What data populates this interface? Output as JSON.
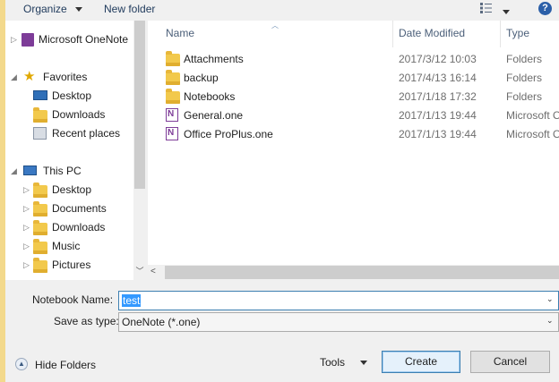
{
  "toolbar": {
    "organize_label": "Organize",
    "new_folder_label": "New folder"
  },
  "nav": {
    "onenote_label": "Microsoft OneNote",
    "favorites_label": "Favorites",
    "favorites_items": [
      "Desktop",
      "Downloads",
      "Recent places"
    ],
    "thispc_label": "This PC",
    "thispc_items": [
      "Desktop",
      "Documents",
      "Downloads",
      "Music",
      "Pictures"
    ]
  },
  "columns": {
    "name": "Name",
    "date_modified": "Date Modified",
    "type": "Type"
  },
  "files": [
    {
      "name": "Attachments",
      "date": "2017/3/12 10:03",
      "type": "Folders",
      "icon": "folder"
    },
    {
      "name": "backup",
      "date": "2017/4/13 16:14",
      "type": "Folders",
      "icon": "folder"
    },
    {
      "name": "Notebooks",
      "date": "2017/1/18 17:32",
      "type": "Folders",
      "icon": "folder"
    },
    {
      "name": "General.one",
      "date": "2017/1/13 19:44",
      "type": "Microsoft O",
      "icon": "onenote"
    },
    {
      "name": "Office ProPlus.one",
      "date": "2017/1/13 19:44",
      "type": "Microsoft O",
      "icon": "onenote"
    }
  ],
  "form": {
    "notebook_name_label": "Notebook Name:",
    "notebook_name_value": "test",
    "save_as_type_label": "Save as type:",
    "save_as_type_value": "OneNote (*.one)"
  },
  "footer": {
    "hide_folders_label": "Hide Folders",
    "tools_label": "Tools",
    "create_label": "Create",
    "cancel_label": "Cancel"
  }
}
